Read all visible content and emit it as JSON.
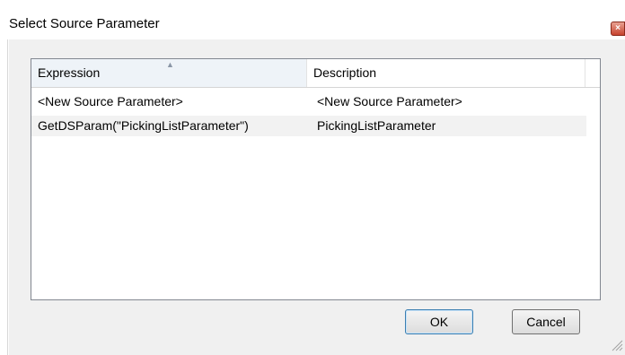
{
  "window": {
    "title": "Select Source Parameter",
    "close_glyph": "×"
  },
  "list": {
    "columns": [
      {
        "label": "Expression",
        "sorted": "ascending"
      },
      {
        "label": "Description"
      }
    ],
    "sort_indicator": "▲",
    "rows": [
      {
        "expression": "<New Source Parameter>",
        "description": "<New Source Parameter>"
      },
      {
        "expression": "GetDSParam(\"PickingListParameter\")",
        "description": "PickingListParameter"
      }
    ]
  },
  "buttons": {
    "ok": "OK",
    "cancel": "Cancel"
  },
  "icons": {
    "close": "close-icon",
    "sort": "sort-ascending-icon",
    "resize": "resize-grip-icon"
  }
}
